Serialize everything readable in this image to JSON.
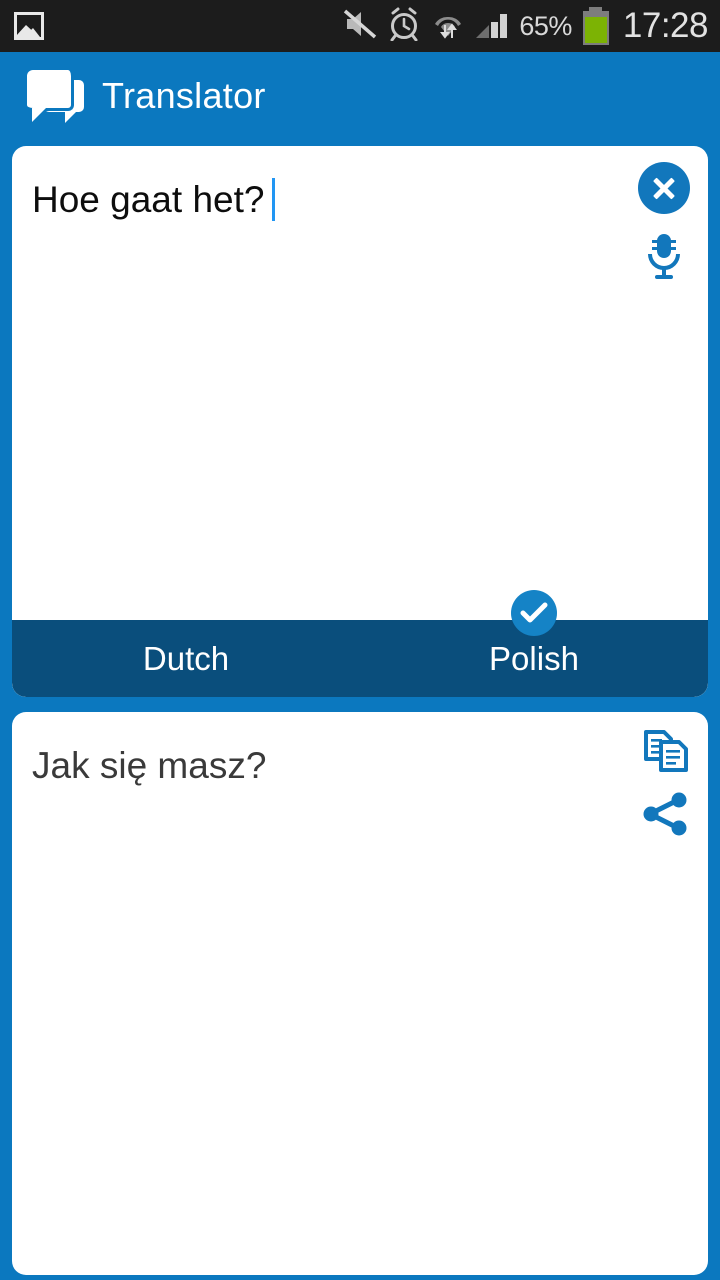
{
  "status_bar": {
    "icons": [
      "photo-icon",
      "volume-mute-icon",
      "alarm-clock-icon",
      "wifi-data-icon",
      "signal-bars-icon"
    ],
    "battery_percent": "65%",
    "time": "17:28"
  },
  "header": {
    "title": "Translator",
    "logo_icon": "speech-bubbles-icon"
  },
  "input_card": {
    "text": "Hoe gaat het?",
    "clear_label": "clear-icon",
    "mic_label": "microphone-icon"
  },
  "language_bar": {
    "source_language": "Dutch",
    "target_language": "Polish",
    "selected": "Polish",
    "check_icon": "check-icon"
  },
  "output_card": {
    "text": "Jak się masz?",
    "copy_label": "copy-icon",
    "share_label": "share-icon"
  },
  "colors": {
    "brand_blue": "#0B78BF",
    "dark_blue": "#0A4E7C",
    "icon_blue": "#1277BC",
    "battery_green": "#7cb304",
    "status_bg": "#1C1C1C"
  }
}
